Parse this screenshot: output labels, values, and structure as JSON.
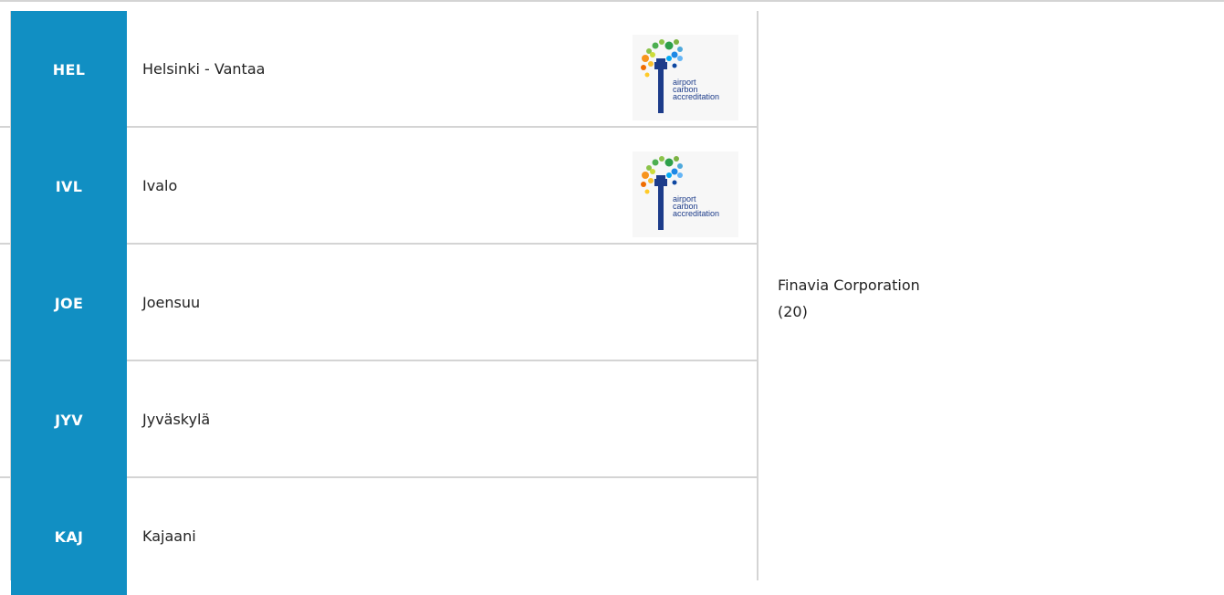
{
  "rows": [
    {
      "code": "HEL",
      "name": "Helsinki - Vantaa",
      "has_aca_logo": true
    },
    {
      "code": "IVL",
      "name": "Ivalo",
      "has_aca_logo": true
    },
    {
      "code": "JOE",
      "name": "Joensuu",
      "has_aca_logo": false
    },
    {
      "code": "JYV",
      "name": "Jyväskylä",
      "has_aca_logo": false
    },
    {
      "code": "KAJ",
      "name": "Kajaani",
      "has_aca_logo": false
    }
  ],
  "operator": {
    "name": "Finavia Corporation",
    "count": "(20)"
  },
  "aca_logo": {
    "line1": "airport",
    "line2": "carbon",
    "line3": "accreditation"
  },
  "colors": {
    "code_bg": "#118fc3",
    "border": "#d4d4d4",
    "logo_text": "#1d3c8a"
  }
}
